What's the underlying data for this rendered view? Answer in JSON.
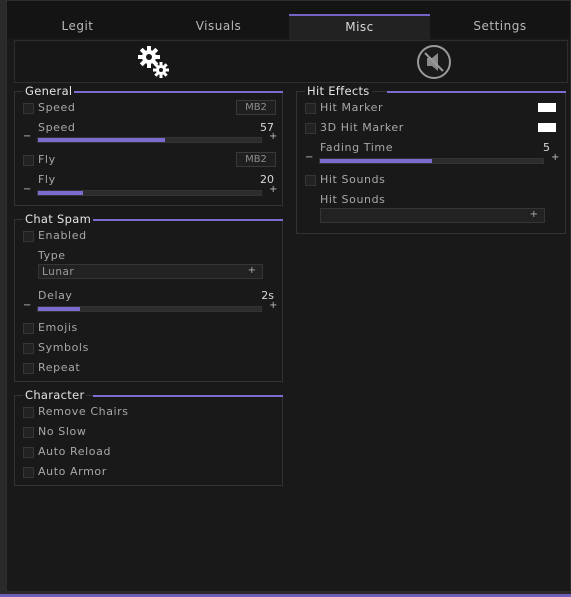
{
  "tabs": [
    "Legit",
    "Visuals",
    "Misc",
    "Settings"
  ],
  "active_tab": "Misc",
  "icons": {
    "left": "gears-icon",
    "right": "no-audio-icon"
  },
  "colors": {
    "accent": "#7d6bd0",
    "hit_marker": "#ffffff",
    "hit3d_marker": "#ffffff"
  },
  "general": {
    "title": "General",
    "speed_toggle": "Speed",
    "speed_key": "MB2",
    "speed_label": "Speed",
    "speed_value": "57",
    "speed_fraction": 0.57,
    "fly_toggle": "Fly",
    "fly_key": "MB2",
    "fly_label": "Fly",
    "fly_value": "20",
    "fly_fraction": 0.2,
    "minus": "−",
    "plus": "+"
  },
  "chat_spam": {
    "title": "Chat Spam",
    "enabled": "Enabled",
    "type_label": "Type",
    "type_value": "Lunar",
    "delay_label": "Delay",
    "delay_value": "2s",
    "delay_fraction": 0.19,
    "emojis": "Emojis",
    "symbols": "Symbols",
    "repeat": "Repeat",
    "plus": "+",
    "minus": "−"
  },
  "character": {
    "title": "Character",
    "items": [
      "Remove Chairs",
      "No Slow",
      "Auto Reload",
      "Auto Armor"
    ]
  },
  "hit_effects": {
    "title": "Hit Effects",
    "hit_marker": "Hit Marker",
    "hit3d_marker": "3D Hit Marker",
    "fading_label": "Fading Time",
    "fading_value": "5",
    "fading_fraction": 0.5,
    "hit_sounds_toggle": "Hit Sounds",
    "hit_sounds_label": "Hit Sounds",
    "hit_sounds_value": "",
    "minus": "−",
    "plus": "+"
  }
}
